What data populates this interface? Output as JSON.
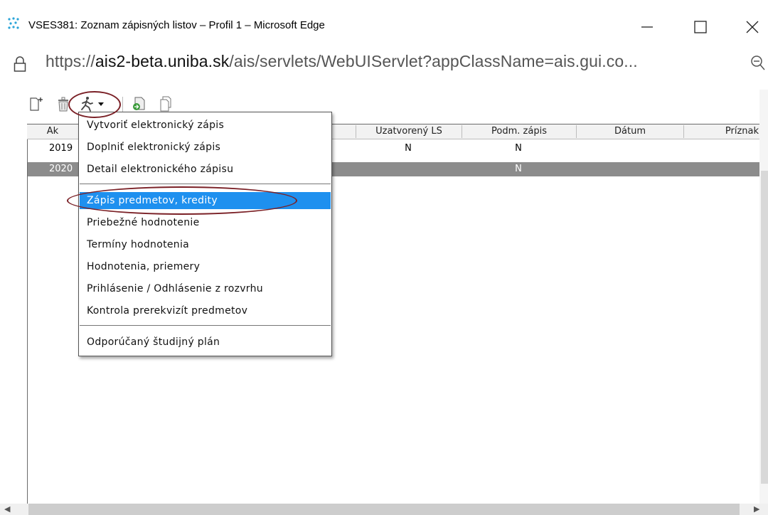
{
  "window": {
    "title": "VSES381: Zoznam zápisných listov – Profil 1 – Microsoft Edge",
    "minimize": "—",
    "maximize": "☐",
    "close": "✕"
  },
  "address": {
    "url_prefix": "https://",
    "url_domain": "ais2-beta.uniba.sk",
    "url_rest": "/ais/servlets/WebUIServlet?appClassName=ais.gui.co...",
    "lock_icon": "lock-icon",
    "zoom_icon": "zoom-out-icon"
  },
  "toolbar": {
    "icons": [
      "new-document-icon",
      "delete-icon",
      "run-action-icon",
      "export-icon",
      "copy-icon"
    ],
    "dropdown_arrow": "▾"
  },
  "table": {
    "columns": [
      "Ak",
      "Uzatvorený LS",
      "Podm. zápis",
      "Dátum",
      "Príznak"
    ],
    "rows": [
      {
        "year": "2019",
        "uzatvoreny": "N",
        "podm": "N"
      },
      {
        "year": "2020",
        "uzatvoreny": "",
        "podm": "N"
      }
    ]
  },
  "menu": {
    "items": [
      {
        "label": "Vytvoriť elektronický zápis"
      },
      {
        "label": "Doplniť elektronický zápis"
      },
      {
        "label": "Detail elektronického zápisu"
      },
      {
        "label": "Zápis predmetov, kredity"
      },
      {
        "label": "Priebežné hodnotenie"
      },
      {
        "label": "Termíny hodnotenia"
      },
      {
        "label": "Hodnotenia, priemery"
      },
      {
        "label": "Prihlásenie / Odhlásenie z rozvrhu"
      },
      {
        "label": "Kontrola prerekvizít predmetov"
      },
      {
        "label": "Odporúčaný študijný plán"
      }
    ],
    "selected_index": 3,
    "selected_color": "#1e90ef"
  },
  "annotation_color": "#7a2026"
}
